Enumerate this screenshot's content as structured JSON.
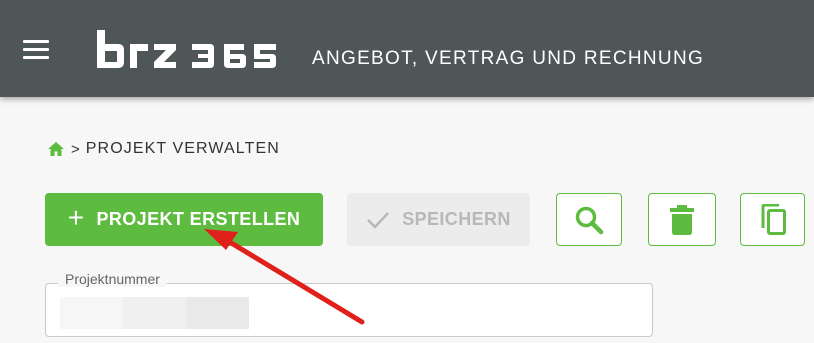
{
  "header": {
    "logo_text": "brz 365",
    "title": "ANGEBOT, VERTRAG UND RECHNUNG",
    "menu_icon": "menu-icon"
  },
  "breadcrumb": {
    "home_icon": "home-icon",
    "separator": ">",
    "current": "PROJEKT VERWALTEN"
  },
  "toolbar": {
    "create_label": "PROJEKT ERSTELLEN",
    "create_icon": "plus",
    "save_label": "SPEICHERN",
    "save_icon": "checkmark-icon",
    "search_icon": "search-icon",
    "delete_icon": "trash-icon",
    "copy_icon": "copy-icon"
  },
  "form": {
    "project_number_label": "Projektnummer",
    "project_number_value": ""
  },
  "colors": {
    "appbar": "#4f5657",
    "accent": "#5dbb3f",
    "disabled_bg": "#ececec",
    "disabled_text": "#b8b8b8",
    "annotation_arrow": "#e0201b"
  }
}
